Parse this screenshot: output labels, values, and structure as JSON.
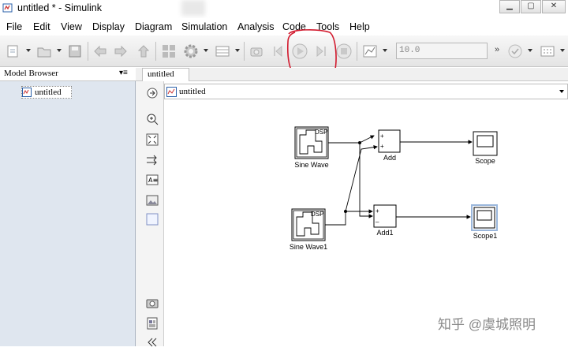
{
  "window": {
    "title": "untitled * - Simulink"
  },
  "menu": [
    "File",
    "Edit",
    "View",
    "Display",
    "Diagram",
    "Simulation",
    "Analysis",
    "Code",
    "Tools",
    "Help"
  ],
  "toolbar": {
    "stop_time": "10.0"
  },
  "model_browser": {
    "title": "Model Browser",
    "root": "untitled"
  },
  "tab": {
    "label": "untitled"
  },
  "explorer_bar": {
    "path": "untitled"
  },
  "blocks": {
    "sine1": {
      "label": "Sine Wave",
      "badge": "DSP"
    },
    "sine2": {
      "label": "Sine Wave1",
      "badge": "DSP"
    },
    "add1": {
      "label": "Add"
    },
    "add2": {
      "label": "Add1"
    },
    "scope1": {
      "label": "Scope"
    },
    "scope2": {
      "label": "Scope1"
    },
    "plus": "+",
    "minus": "–"
  },
  "watermark": "知乎 @虞城照明",
  "colors": {
    "annotation": "#d21a2e",
    "panel": "#dfe6ef"
  }
}
